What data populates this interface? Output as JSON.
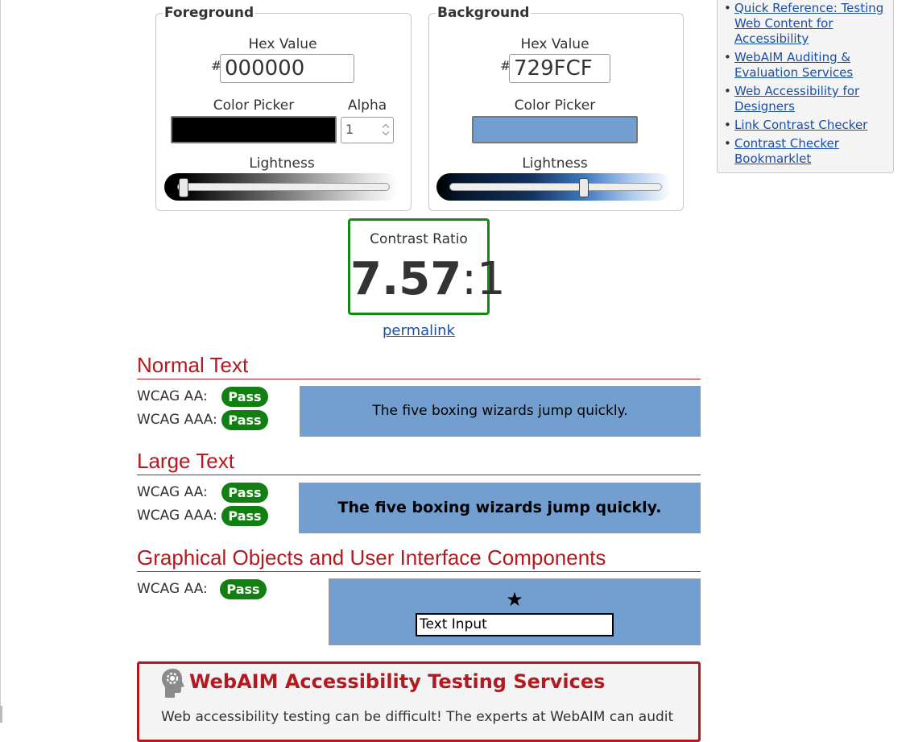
{
  "foreground": {
    "legend": "Foreground",
    "hex_label": "Hex Value",
    "hash": "#",
    "hex_value": "000000",
    "picker_label": "Color Picker",
    "alpha_label": "Alpha",
    "alpha_value": "1",
    "lightness_label": "Lightness",
    "color": "#000000",
    "lightness_level": 0
  },
  "background": {
    "legend": "Background",
    "hex_label": "Hex Value",
    "hash": "#",
    "hex_value": "729FCF",
    "picker_label": "Color Picker",
    "lightness_label": "Lightness",
    "color": "#729fcf",
    "lightness_level": 0.63
  },
  "contrast": {
    "title": "Contrast Ratio",
    "value": "7.57",
    "suffix": ":1",
    "permalink": "permalink"
  },
  "sections": {
    "normal": {
      "heading": "Normal Text",
      "aa_label": "WCAG AA:",
      "aa_result": "Pass",
      "aaa_label": "WCAG AAA:",
      "aaa_result": "Pass",
      "sample": "The five boxing wizards jump quickly."
    },
    "large": {
      "heading": "Large Text",
      "aa_label": "WCAG AA:",
      "aa_result": "Pass",
      "aaa_label": "WCAG AAA:",
      "aaa_result": "Pass",
      "sample": "The five boxing wizards jump quickly."
    },
    "graphics": {
      "heading": "Graphical Objects and User Interface Components",
      "aa_label": "WCAG AA:",
      "aa_result": "Pass",
      "star": "★",
      "input_value": "Text Input"
    }
  },
  "promo": {
    "title": "WebAIM Accessibility Testing Services",
    "text": "Web accessibility testing can be difficult! The experts at WebAIM can audit"
  },
  "sidebar": {
    "links": [
      "Quick Reference: Testing Web Content for Accessibility",
      "WebAIM Auditing & Evaluation Services",
      "Web Accessibility for Designers",
      "Link Contrast Checker",
      "Contrast Checker Bookmarklet"
    ]
  },
  "colors": {
    "pass_green": "#127f12",
    "heading_red": "#b3191f",
    "link_blue": "#1a4fa8",
    "contrast_border": "#138a13"
  }
}
